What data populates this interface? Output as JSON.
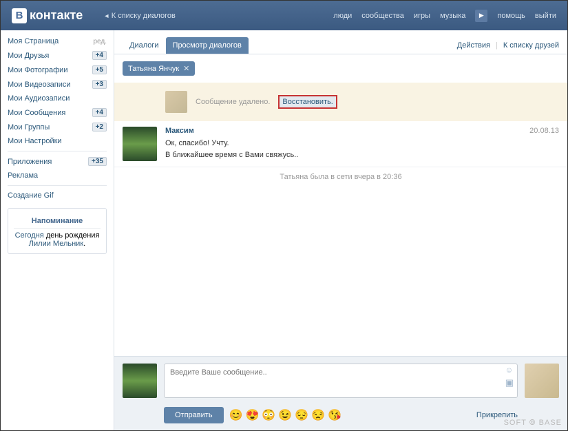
{
  "header": {
    "logo": "контакте",
    "back": "К списку диалогов",
    "nav": [
      "люди",
      "сообщества",
      "игры",
      "музыка"
    ],
    "nav2": [
      "помощь",
      "выйти"
    ]
  },
  "sidebar": {
    "items": [
      {
        "label": "Моя Страница",
        "extra_label": "ред."
      },
      {
        "label": "Мои Друзья",
        "badge": "+4"
      },
      {
        "label": "Мои Фотографии",
        "badge": "+5"
      },
      {
        "label": "Мои Видеозаписи",
        "badge": "+3"
      },
      {
        "label": "Мои Аудиозаписи"
      },
      {
        "label": "Мои Сообщения",
        "badge": "+4"
      },
      {
        "label": "Мои Группы",
        "badge": "+2"
      },
      {
        "label": "Мои Настройки"
      }
    ],
    "items2": [
      {
        "label": "Приложения",
        "badge": "+35"
      },
      {
        "label": "Реклама"
      }
    ],
    "items3": [
      {
        "label": "Создание Gif"
      }
    ]
  },
  "reminder": {
    "title": "Напоминание",
    "today": "Сегодня",
    "body": " день рождения ",
    "name": "Лилии Мельник",
    "dot": "."
  },
  "tabs": {
    "dialog": "Диалоги",
    "view": "Просмотр диалогов",
    "actions": "Действия",
    "friends": "К списку друзей"
  },
  "user_tag": "Татьяна Янчук",
  "deleted": {
    "text": "Сообщение удалено.",
    "restore": "Восстановить."
  },
  "message": {
    "author": "Максим",
    "date": "20.08.13",
    "line1": "Ок, спасибо! Учту.",
    "line2": "В ближайшее время с Вами свяжусь.."
  },
  "last_seen": "Татьяна была в сети вчера в 20:36",
  "compose": {
    "placeholder": "Введите Ваше сообщение..",
    "send": "Отправить",
    "attach": "Прикрепить"
  },
  "watermark": "SOFT ⦾ BASE"
}
